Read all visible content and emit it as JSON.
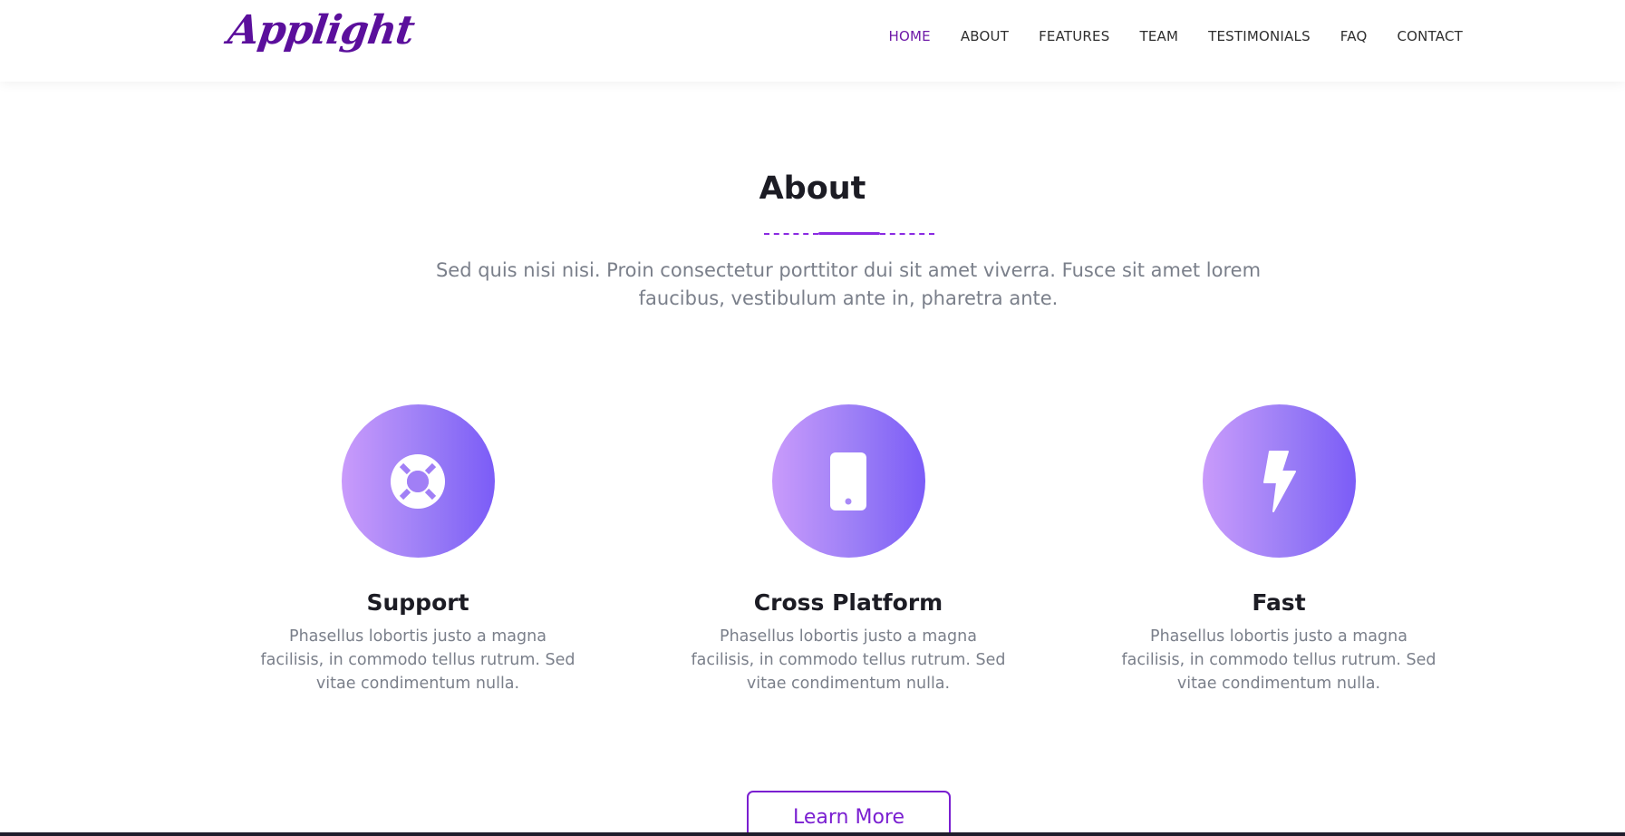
{
  "brand": {
    "name": "Applight",
    "color": "#5b0f9c"
  },
  "nav": {
    "items": [
      {
        "label": "HOME",
        "active": true
      },
      {
        "label": "ABOUT"
      },
      {
        "label": "FEATURES"
      },
      {
        "label": "TEAM"
      },
      {
        "label": "TESTIMONIALS"
      },
      {
        "label": "FAQ"
      },
      {
        "label": "CONTACT"
      }
    ],
    "active_color": "#6f1aa8"
  },
  "about": {
    "title": "About",
    "description": "Sed quis nisi nisi. Proin consectetur porttitor dui sit amet viverra. Fusce sit amet lorem faucibus, vestibulum ante in, pharetra ante.",
    "features": [
      {
        "icon": "life-ring-icon",
        "title": "Support",
        "text": "Phasellus lobortis justo a magna facilisis, in commodo tellus rutrum. Sed vitae condimentum nulla."
      },
      {
        "icon": "mobile-phone-icon",
        "title": "Cross Platform",
        "text": "Phasellus lobortis justo a magna facilisis, in commodo tellus rutrum. Sed vitae condimentum nulla."
      },
      {
        "icon": "lightning-bolt-icon",
        "title": "Fast",
        "text": "Phasellus lobortis justo a magna facilisis, in commodo tellus rutrum. Sed vitae condimentum nulla."
      }
    ],
    "button_label": "Learn More"
  },
  "colors": {
    "accent": "#8a2be2",
    "icon_gradient_start": "#c99bfb",
    "icon_gradient_end": "#7b5cf7"
  }
}
